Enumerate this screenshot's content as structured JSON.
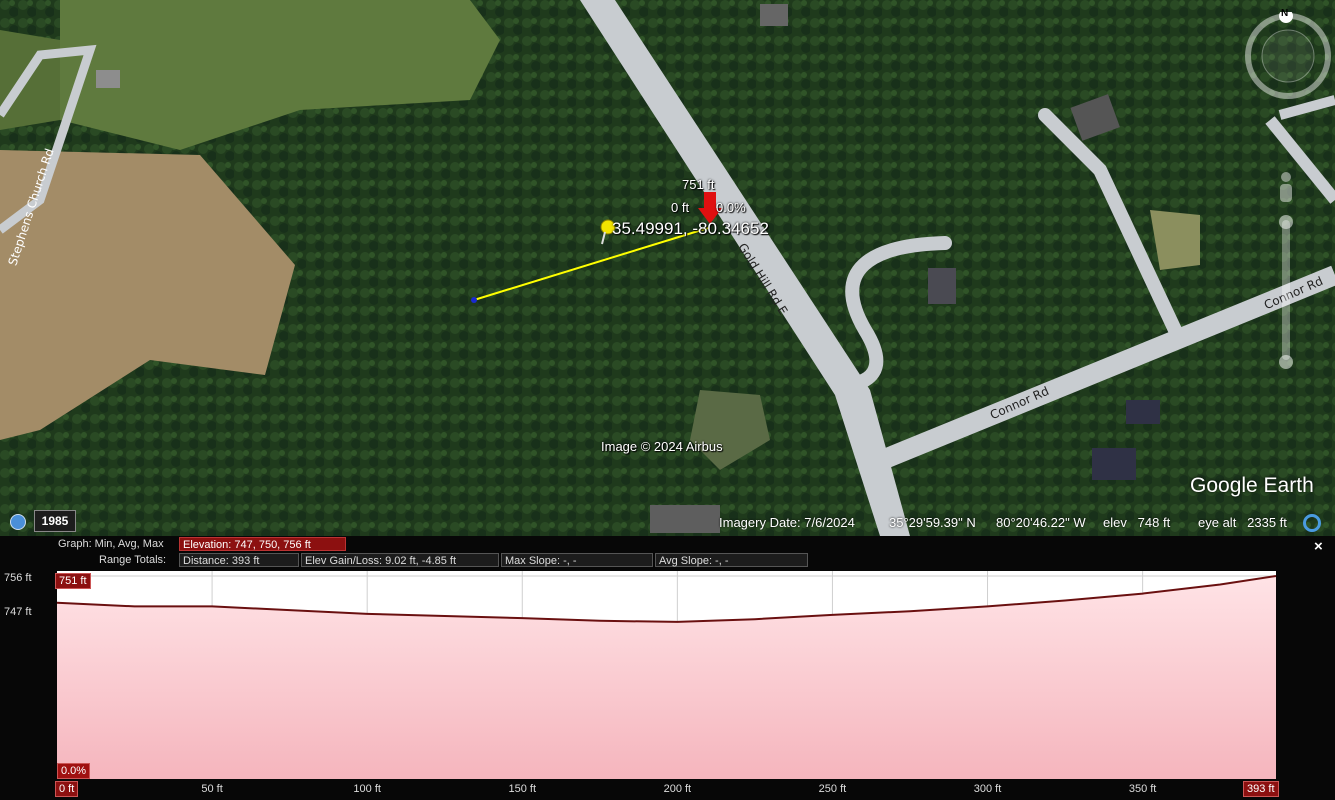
{
  "map": {
    "road_labels": {
      "gold_hill": "Gold Hill Rd E",
      "connor_upper": "Connor Rd",
      "connor_lower": "Connor Rd",
      "church": "Stephens Church Rd"
    },
    "cursor": {
      "elevation": "751 ft",
      "distance": "0 ft",
      "slope": "0.0%",
      "coordinates": "35.49991, -80.34652"
    },
    "attribution": "Image © 2024 Airbus",
    "logo": "Google Earth",
    "history_year": "1985",
    "compass_letter": "N",
    "status": {
      "imagery_date": "Imagery Date: 7/6/2024",
      "lat": "35°29'59.39\" N",
      "lon": "80°20'46.22\" W",
      "elev": "elev   748 ft",
      "eye_alt": "eye alt   2335 ft"
    }
  },
  "profile": {
    "graph_label": "Graph: Min, Avg, Max",
    "elevation_stat": "Elevation: 747, 750, 756 ft",
    "range_label": "Range Totals:",
    "distance": "Distance: 393 ft",
    "gain_loss": "Elev Gain/Loss: 9.02 ft, -4.85 ft",
    "max_slope": "Max Slope: -, -",
    "avg_slope": "Avg Slope: -, -",
    "close": "×",
    "y_max_label": "756 ft",
    "y_min_label": "747 ft",
    "cursor_elev_tag": "751 ft",
    "cursor_slope_tag": "0.0%",
    "x_start_tag": "0 ft",
    "x_end_tag": "393 ft",
    "x_ticks": [
      "50 ft",
      "100 ft",
      "150 ft",
      "200 ft",
      "250 ft",
      "300 ft",
      "350 ft"
    ]
  },
  "chart_data": {
    "type": "area",
    "xlabel": "",
    "ylabel": "",
    "x": [
      0,
      25,
      50,
      75,
      100,
      125,
      150,
      175,
      200,
      225,
      250,
      275,
      300,
      325,
      350,
      375,
      393
    ],
    "y": [
      751,
      750.3,
      750.3,
      749.6,
      748.9,
      748.5,
      748.1,
      747.6,
      747.4,
      747.9,
      748.7,
      749.4,
      750.3,
      751.4,
      752.7,
      754.4,
      756
    ],
    "xlim": [
      0,
      393
    ],
    "ylim": [
      747,
      756
    ],
    "x_ticks": [
      50,
      100,
      150,
      200,
      250,
      300,
      350
    ],
    "grid": true
  }
}
